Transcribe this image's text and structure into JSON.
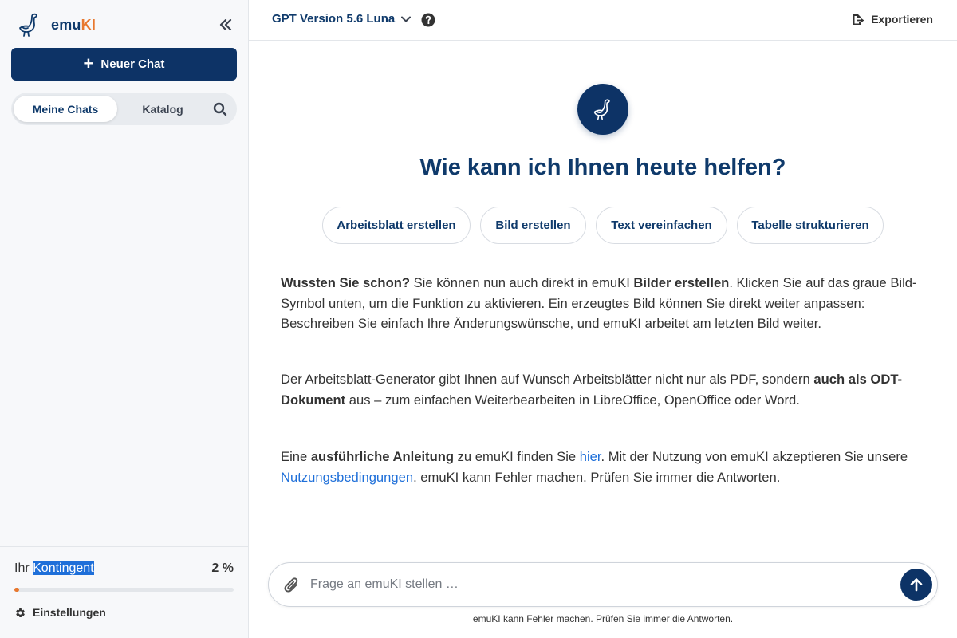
{
  "brand": {
    "name_part1": "emu",
    "name_part2": "KI",
    "accent_color": "#e8782e",
    "primary_color": "#0d3366"
  },
  "sidebar": {
    "new_chat_label": "Neuer Chat",
    "tabs": [
      {
        "label": "Meine Chats",
        "active": true
      },
      {
        "label": "Katalog",
        "active": false
      }
    ],
    "quota": {
      "label_prefix": "Ihr",
      "label_highlight": "Kontingent",
      "value": "2 %",
      "fraction": 0.02
    },
    "settings_label": "Einstellungen"
  },
  "topbar": {
    "model_name": "GPT Version 5.6 Luna",
    "export_label": "Exportieren"
  },
  "main": {
    "title": "Wie kann ich Ihnen heute helfen?",
    "chips": [
      "Arbeitsblatt erstellen",
      "Bild erstellen",
      "Text vereinfachen",
      "Tabelle strukturieren"
    ],
    "info": {
      "p1_b1": "Wussten Sie schon?",
      "p1_t1": " Sie können nun auch direkt in emuKI ",
      "p1_b2": "Bilder erstellen",
      "p1_t2": ". Klicken Sie auf das graue Bild-Symbol unten, um die Funktion zu aktivieren. Ein erzeugtes Bild können Sie direkt weiter anpassen: Beschreiben Sie einfach Ihre Änderungswünsche, und emuKI arbeitet am letzten Bild weiter.",
      "p2_t1": "Der Arbeitsblatt-Generator gibt Ihnen auf Wunsch Arbeitsblätter nicht nur als PDF, sondern ",
      "p2_b1": "auch als ODT-Dokument",
      "p2_t2": " aus – zum einfachen Weiterbearbeiten in LibreOffice, OpenOffice oder Word.",
      "p3_t1": "Eine ",
      "p3_b1": "ausführliche Anleitung",
      "p3_t2": " zu emuKI finden Sie ",
      "p3_link1": "hier",
      "p3_t3": ". Mit der Nutzung von emuKI akzeptieren Sie unsere ",
      "p3_link2": "Nutzungsbedingungen",
      "p3_t4": ". emuKI kann Fehler machen. Prüfen Sie immer die Antworten."
    }
  },
  "composer": {
    "placeholder": "Frage an emuKI stellen …",
    "disclaimer": "emuKI kann Fehler machen. Prüfen Sie immer die Antworten."
  },
  "icons": {
    "logo": "emu-bird-icon",
    "collapse": "double-chevron-left-icon",
    "plus": "plus-icon",
    "search": "search-icon",
    "settings": "gear-icon",
    "dropdown": "chevron-down-icon",
    "help": "question-circle-icon",
    "export": "export-icon",
    "attach": "paperclip-icon",
    "send": "arrow-up-icon"
  }
}
